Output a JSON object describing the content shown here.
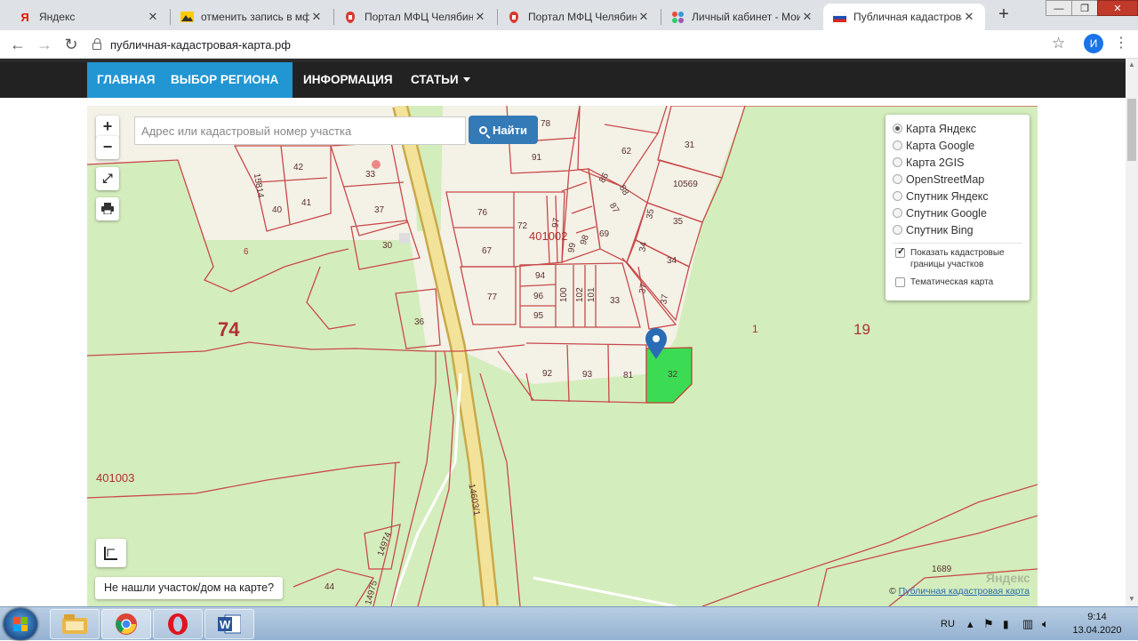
{
  "browser": {
    "tabs": [
      {
        "label": "Яндекс",
        "icon": "yandex-icon",
        "active": false
      },
      {
        "label": "отменить запись в мфц",
        "icon": "yandex-images-icon",
        "active": false
      },
      {
        "label": "Портал МФЦ Челябинск",
        "icon": "mfc-icon",
        "active": false
      },
      {
        "label": "Портал МФЦ Челябинск",
        "icon": "mfc-icon",
        "active": false
      },
      {
        "label": "Личный кабинет - Мои",
        "icon": "gosuslugi-icon",
        "active": false
      },
      {
        "label": "Публичная кадастровая",
        "icon": "russia-flag-icon",
        "active": true
      }
    ],
    "new_tab": "+",
    "url": "публичная-кадастровая-карта.рф",
    "profile_initial": "И"
  },
  "site_nav": {
    "items": [
      {
        "label": "ГЛАВНАЯ",
        "dropdown": false,
        "active": true
      },
      {
        "label": "ВЫБОР РЕГИОНА",
        "dropdown": true,
        "active": true
      },
      {
        "label": "ИНФОРМАЦИЯ",
        "dropdown": false,
        "active": false
      },
      {
        "label": "СТАТЬИ",
        "dropdown": true,
        "active": false
      }
    ]
  },
  "map": {
    "zoom_in": "+",
    "zoom_out": "−",
    "search": {
      "placeholder": "Адрес или кадастровый номер участка",
      "value": ""
    },
    "find_label": "Найти",
    "layers": [
      {
        "label": "Карта Яндекс",
        "selected": true
      },
      {
        "label": "Карта Google",
        "selected": false
      },
      {
        "label": "Карта 2GIS",
        "selected": false
      },
      {
        "label": "OpenStreetMap",
        "selected": false
      },
      {
        "label": "Спутник Яндекс",
        "selected": false
      },
      {
        "label": "Спутник Google",
        "selected": false
      },
      {
        "label": "Спутник Bing",
        "selected": false
      }
    ],
    "options": [
      {
        "label": "Показать кадастровые границы участков",
        "checked": true
      },
      {
        "label": "Тематическая карта",
        "checked": false
      }
    ],
    "not_found_label": "Не нашли участок/дом на карте?",
    "attribution": "Публичная кадастровая карта",
    "attribution_prefix": "©",
    "watermark": "Яндекс",
    "labels": {
      "region_74": "74",
      "region_19": "19",
      "quarter_401002": "401002",
      "quarter_401003": "401003",
      "p1": "1",
      "p6": "6",
      "p15814": "15814",
      "p42": "42",
      "p33a": "33",
      "p40": "40",
      "p41": "41",
      "p37a": "37",
      "p30": "30",
      "p36": "36",
      "p78": "78",
      "p91": "91",
      "p62": "62",
      "p31": "31",
      "p86": "86",
      "p88": "88",
      "p87": "87",
      "p10569": "10569",
      "p35a": "35",
      "p35b": "35",
      "p76": "76",
      "p72": "72",
      "p97": "97",
      "p99": "99",
      "p98": "98",
      "p69": "69",
      "p34a": "34",
      "p34b": "34",
      "p67": "67",
      "p94": "94",
      "p96": "96",
      "p95": "95",
      "p100": "100",
      "p102": "102",
      "p101": "101",
      "p33b": "33",
      "p37b": "37",
      "p37c": "37",
      "p77": "77",
      "p92": "92",
      "p93": "93",
      "p81": "81",
      "p32": "32",
      "p14603": "14603/1",
      "p14974": "14974",
      "p14975": "14975",
      "p44": "44",
      "p1689": "1689"
    }
  },
  "taskbar": {
    "apps": [
      "explorer-icon",
      "chrome-icon",
      "opera-icon",
      "word-icon"
    ],
    "language": "RU",
    "time": "9:14",
    "date": "13.04.2020"
  }
}
